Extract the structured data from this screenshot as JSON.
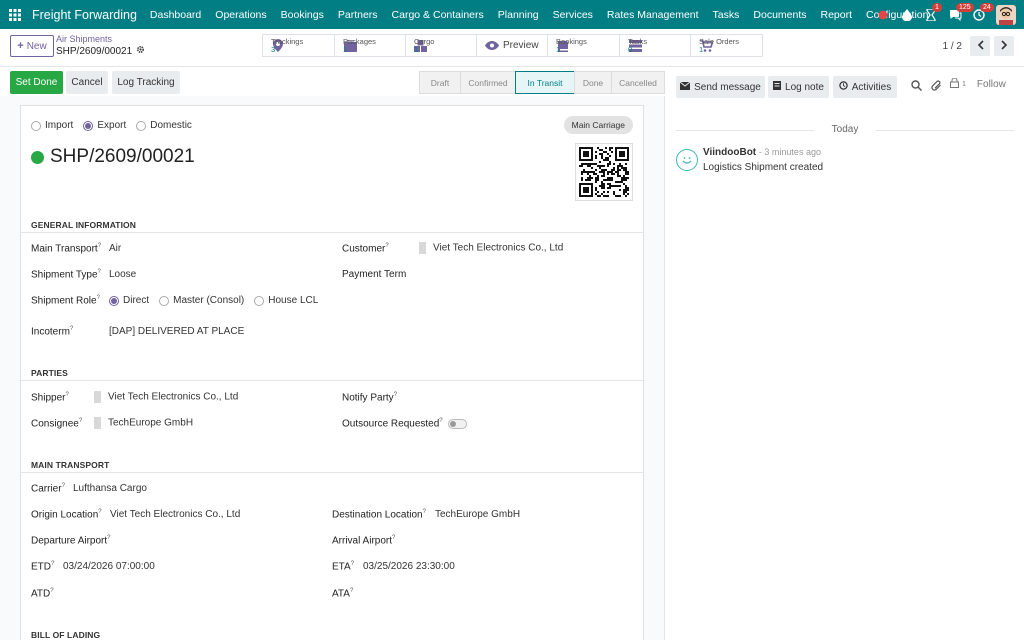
{
  "app": {
    "title": "Freight Forwarding"
  },
  "menu": [
    "Dashboard",
    "Operations",
    "Bookings",
    "Partners",
    "Cargo & Containers",
    "Planning",
    "Services",
    "Rates Management",
    "Tasks",
    "Documents",
    "Report",
    "Configuration"
  ],
  "systray": {
    "activity_count": "1",
    "messages_count": "125",
    "activities_count": "24"
  },
  "control": {
    "new_label": "New",
    "breadcrumb_parent": "Air Shipments",
    "breadcrumb_current": "SHP/2609/00021",
    "pager": "1 / 2"
  },
  "smart_buttons": [
    {
      "title": "Trackings",
      "value": "3",
      "icon": "map-pin-icon"
    },
    {
      "title": "Packages",
      "value": "1",
      "icon": "box-icon"
    },
    {
      "title": "Cargo",
      "value": "1",
      "icon": "cubes-icon"
    },
    {
      "title": "Preview",
      "icon": "eye-icon"
    },
    {
      "title": "Bookings",
      "value": "1",
      "icon": "book-icon"
    },
    {
      "title": "Tasks",
      "value": "0",
      "icon": "tasks-icon"
    },
    {
      "title": "Sale Orders",
      "value": "1",
      "icon": "cart-icon"
    }
  ],
  "actions": {
    "set_done": "Set Done",
    "cancel": "Cancel",
    "log_tracking": "Log Tracking"
  },
  "stages": [
    "Draft",
    "Confirmed",
    "In Transit",
    "Done",
    "Cancelled"
  ],
  "active_stage": "In Transit",
  "form": {
    "direction_options": [
      "Import",
      "Export",
      "Domestic"
    ],
    "direction_selected": "Export",
    "badge": "Main Carriage",
    "title": "SHP/2609/00021",
    "general_section": "GENERAL INFORMATION",
    "main_transport_label": "Main Transport",
    "main_transport_value": "Air",
    "customer_label": "Customer",
    "customer_value": "Viet Tech Electronics Co., Ltd",
    "shipment_type_label": "Shipment Type",
    "shipment_type_value": "Loose",
    "payment_term_label": "Payment Term",
    "shipment_role_label": "Shipment Role",
    "role_options": [
      "Direct",
      "Master (Consol)",
      "House LCL"
    ],
    "role_selected": "Direct",
    "incoterm_label": "Incoterm",
    "incoterm_value": "[DAP] DELIVERED AT PLACE",
    "parties_section": "PARTIES",
    "shipper_label": "Shipper",
    "shipper_value": "Viet Tech Electronics Co., Ltd",
    "notify_label": "Notify Party",
    "consignee_label": "Consignee",
    "consignee_value": "TechEurope GmbH",
    "outsource_label": "Outsource Requested",
    "main_transport_section": "MAIN TRANSPORT",
    "carrier_label": "Carrier",
    "carrier_value": "Lufthansa Cargo",
    "origin_label": "Origin Location",
    "origin_value": "Viet Tech Electronics Co., Ltd",
    "destination_label": "Destination Location",
    "destination_value": "TechEurope GmbH",
    "dep_airport_label": "Departure Airport",
    "arr_airport_label": "Arrival Airport",
    "etd_label": "ETD",
    "etd_value": "03/24/2026 07:00:00",
    "eta_label": "ETA",
    "eta_value": "03/25/2026 23:30:00",
    "atd_label": "ATD",
    "ata_label": "ATA",
    "bol_section": "BILL OF LADING"
  },
  "chatter": {
    "send_message": "Send message",
    "log_note": "Log note",
    "activities": "Activities",
    "followers_count": "1",
    "follow": "Follow",
    "today": "Today",
    "author": "ViindooBot",
    "time": "- 3 minutes ago",
    "body": "Logistics Shipment created"
  },
  "colors": {
    "brand": "#017e84",
    "primary": "#71639e",
    "success": "#28a745"
  }
}
